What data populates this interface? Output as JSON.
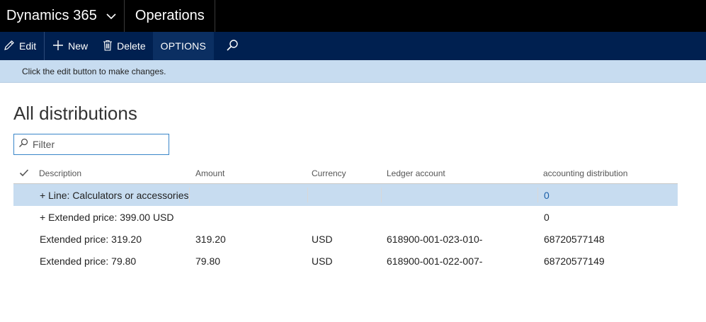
{
  "topbar": {
    "app_title": "Dynamics 365",
    "module_title": "Operations"
  },
  "actions": {
    "edit_label": "Edit",
    "new_label": "New",
    "delete_label": "Delete",
    "options_label": "OPTIONS"
  },
  "message": "Click the edit button to make changes.",
  "page": {
    "title": "All distributions"
  },
  "filter": {
    "placeholder": "Filter",
    "value": ""
  },
  "grid": {
    "columns": [
      "Description",
      "Amount",
      "Currency",
      "Ledger account",
      "accounting distribution"
    ],
    "rows": [
      {
        "description": "+ Line: Calculators or accessories",
        "amount": "",
        "currency": "",
        "ledger": "",
        "distribution": "0",
        "selected": true
      },
      {
        "description": "+ Extended price: 399.00 USD",
        "amount": "",
        "currency": "",
        "ledger": "",
        "distribution": "0",
        "selected": false
      },
      {
        "description": "Extended price: 319.20",
        "amount": "319.20",
        "currency": "USD",
        "ledger": "618900-001-023-010-",
        "distribution": "68720577148",
        "selected": false
      },
      {
        "description": "Extended price: 79.80",
        "amount": "79.80",
        "currency": "USD",
        "ledger": "618900-001-022-007-",
        "distribution": "68720577149",
        "selected": false
      }
    ]
  },
  "colors": {
    "topbar": "#000000",
    "actionbar": "#002050",
    "messagebar": "#c7dcf0",
    "selected_row": "#c7dcf0",
    "link": "#1a5fa8"
  },
  "icons": {
    "app_switch": "chevron-down-icon",
    "edit": "pencil-icon",
    "new": "plus-icon",
    "delete": "trash-icon",
    "search": "search-icon",
    "filter": "search-icon",
    "select_all": "checkmark-icon"
  }
}
